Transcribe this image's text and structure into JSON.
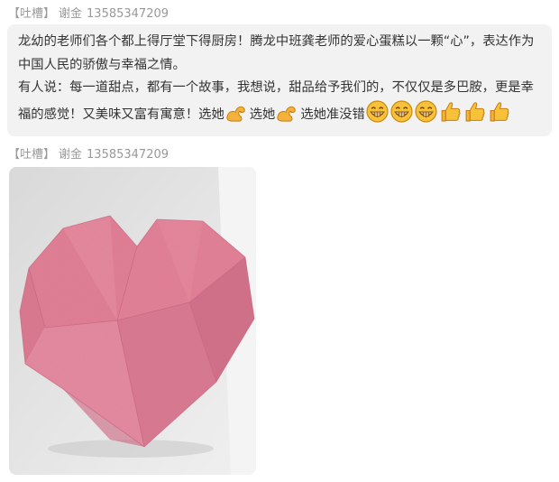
{
  "post1": {
    "tag": "【吐槽】",
    "author": "谢金",
    "phone": "13585347209",
    "paragraph1": "龙幼的老师们各个都上得厅堂下得厨房！腾龙中班龚老师的爱心蛋糕以一颗“心”，表达作为中国人民的骄傲与幸福之情。",
    "paragraph2_prefix": "有人说：每一道甜点，都有一个故事，我想说，甜品给予我们的，不仅仅是多巴胺，更是幸福的感觉！又美味又富有寓意！选她",
    "select1": "选她",
    "select2": "选她准没错",
    "emojis": [
      "strong-arm-icon",
      "strong-arm-icon",
      "grin-icon",
      "grin-icon",
      "grin-icon",
      "thumbs-up-icon",
      "thumbs-up-icon",
      "thumbs-up-icon"
    ]
  },
  "post2": {
    "tag": "【吐槽】",
    "author": "谢金",
    "phone": "13585347209",
    "image": "pink-heart-cake-photo"
  }
}
